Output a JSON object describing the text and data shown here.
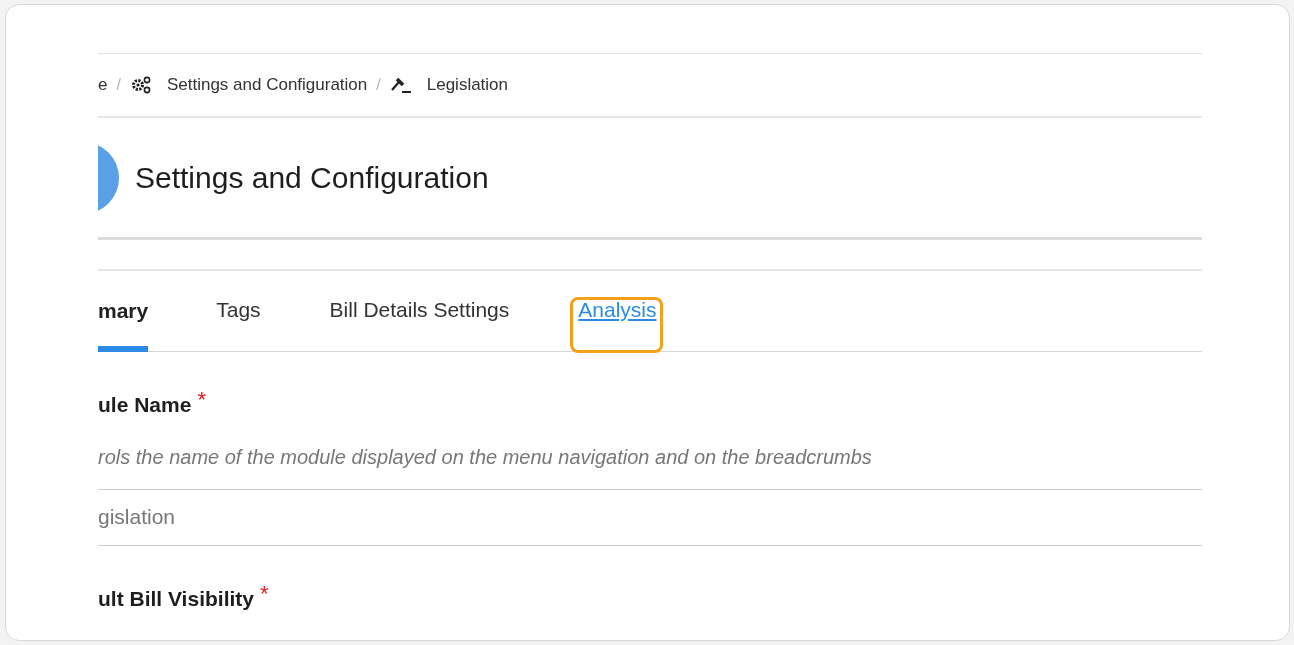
{
  "breadcrumbs": [
    {
      "label": "e",
      "kind": "plain"
    },
    {
      "separator": "/",
      "label": "Settings and Configuration",
      "kind": "settings"
    },
    {
      "separator": "/",
      "label": "Legislation",
      "kind": "module"
    }
  ],
  "page": {
    "title": "Settings and Configuration"
  },
  "tabs": [
    {
      "label": "mary",
      "selected": true,
      "highlighted": false
    },
    {
      "label": "Tags",
      "selected": false,
      "highlighted": false
    },
    {
      "label": "Bill Details Settings",
      "selected": false,
      "highlighted": false
    },
    {
      "label": "Analysis",
      "selected": false,
      "highlighted": true
    }
  ],
  "fields": [
    {
      "label": "ule Name",
      "required_mark": "*",
      "description": "rols the name of the module displayed on the menu navigation and on the breadcrumbs",
      "value": "gislation"
    },
    {
      "label": "ult Bill Visibility",
      "required_mark": "*"
    }
  ]
}
